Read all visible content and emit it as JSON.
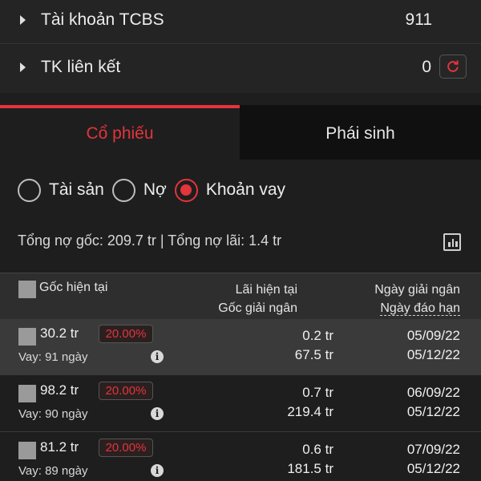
{
  "accounts": [
    {
      "label": "Tài khoản TCBS",
      "value": "911"
    },
    {
      "label": "TK liên kết",
      "value": "0"
    }
  ],
  "tabs": [
    {
      "label": "Cổ phiếu",
      "active": true
    },
    {
      "label": "Phái sinh",
      "active": false
    }
  ],
  "filters": [
    {
      "label": "Tài sản",
      "selected": false
    },
    {
      "label": "Nợ",
      "selected": false
    },
    {
      "label": "Khoản vay",
      "selected": true
    }
  ],
  "summary": "Tổng nợ gốc: 209.7 tr | Tổng nợ lãi: 1.4 tr",
  "table": {
    "col_principal": "Gốc hiện tại",
    "col_interest": "Lãi hiện tại",
    "col_disbursed_principal": "Gốc giải ngân",
    "col_disbursement_date": "Ngày giải ngân",
    "col_maturity_date": "Ngày đáo hạn"
  },
  "loans": [
    {
      "principal": "30.2 tr",
      "rate": "20.00%",
      "term": "Vay: 91 ngày",
      "interest": "0.2 tr",
      "disbursed": "67.5 tr",
      "disbursement_date": "05/09/22",
      "maturity_date": "05/12/22"
    },
    {
      "principal": "98.2 tr",
      "rate": "20.00%",
      "term": "Vay: 90 ngày",
      "interest": "0.7 tr",
      "disbursed": "219.4 tr",
      "disbursement_date": "06/09/22",
      "maturity_date": "05/12/22"
    },
    {
      "principal": "81.2 tr",
      "rate": "20.00%",
      "term": "Vay: 89 ngày",
      "interest": "0.6 tr",
      "disbursed": "181.5 tr",
      "disbursement_date": "07/09/22",
      "maturity_date": "05/12/22"
    }
  ],
  "icons": {
    "caret": "caret-right-icon",
    "refresh": "refresh-icon",
    "chart": "bar-chart-icon",
    "info": "info-icon",
    "checkbox": "checkbox-icon"
  },
  "colors": {
    "accent": "#e4343c",
    "background": "#1e1e1e",
    "row_highlight": "#3a3a3a"
  }
}
